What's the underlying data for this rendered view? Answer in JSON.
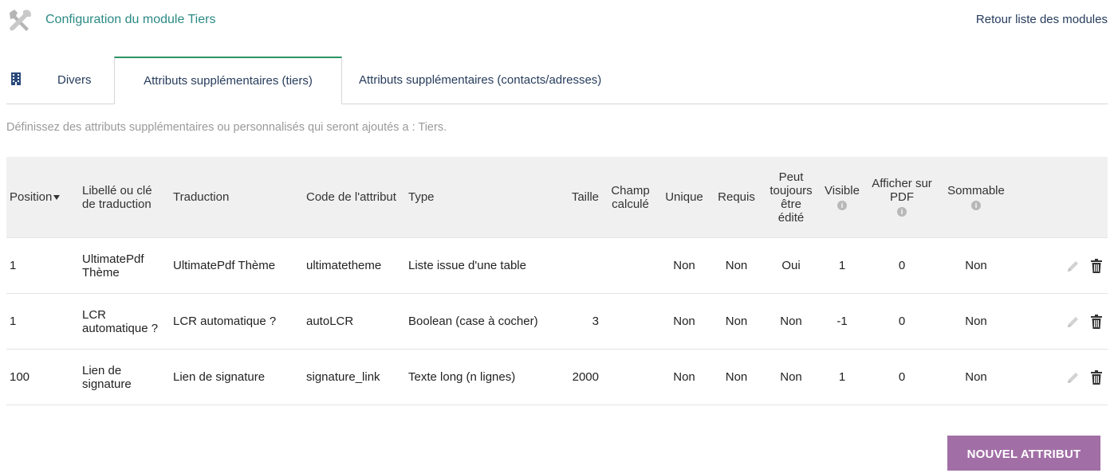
{
  "header": {
    "title": "Configuration du module Tiers",
    "back_link": "Retour liste des modules"
  },
  "tabs": [
    {
      "label": "Divers"
    },
    {
      "label": "Attributs supplémentaires (tiers)",
      "active": true
    },
    {
      "label": "Attributs supplémentaires (contacts/adresses)"
    }
  ],
  "description": "Définissez des attributs supplémentaires ou personnalisés qui seront ajoutés a : Tiers.",
  "table": {
    "headers": {
      "position": "Position",
      "label": "Libellé ou clé de traduction",
      "translation": "Traduction",
      "code": "Code de l'attribut",
      "type": "Type",
      "size": "Taille",
      "computed": "Champ calculé",
      "unique": "Unique",
      "required": "Requis",
      "always_editable": "Peut toujours être édité",
      "visible": "Visible",
      "show_pdf": "Afficher sur PDF",
      "summable": "Sommable"
    },
    "rows": [
      {
        "position": "1",
        "label": "UltimatePdf Thème",
        "translation": "UltimatePdf Thème",
        "code": "ultimatetheme",
        "type": "Liste issue d'une table",
        "size": "",
        "computed": "",
        "unique": "Non",
        "required": "Non",
        "always_editable": "Oui",
        "visible": "1",
        "show_pdf": "0",
        "summable": "Non"
      },
      {
        "position": "1",
        "label": "LCR automatique ?",
        "translation": "LCR automatique ?",
        "code": "autoLCR",
        "type": "Boolean (case à cocher)",
        "size": "3",
        "computed": "",
        "unique": "Non",
        "required": "Non",
        "always_editable": "Non",
        "visible": "-1",
        "show_pdf": "0",
        "summable": "Non"
      },
      {
        "position": "100",
        "label": "Lien de signature",
        "translation": "Lien de signature",
        "code": "signature_link",
        "type": "Texte long (n lignes)",
        "size": "2000",
        "computed": "",
        "unique": "Non",
        "required": "Non",
        "always_editable": "Non",
        "visible": "1",
        "show_pdf": "0",
        "summable": "Non"
      }
    ]
  },
  "new_button": "NOUVEL ATTRIBUT",
  "icons": {
    "header": "tools-icon",
    "tab": "building-icon",
    "sort": "caret-down-icon",
    "info": "info-icon",
    "edit": "pencil-icon",
    "delete": "trash-icon"
  },
  "colors": {
    "title": "#2b8a84",
    "link": "#263c5c",
    "active_tab": "#2c9465",
    "button": "#a16fa6",
    "header_bg": "#f0f0f0"
  }
}
